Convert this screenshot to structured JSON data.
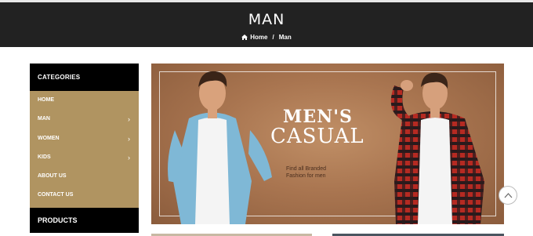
{
  "header": {
    "title": "MAN",
    "breadcrumb": {
      "home": "Home",
      "separator": "/",
      "current": "Man"
    }
  },
  "sidebar": {
    "categories_title": "CATEGORIES",
    "items": [
      {
        "label": "HOME",
        "has_children": false
      },
      {
        "label": "MAN",
        "has_children": true
      },
      {
        "label": "WOMEN",
        "has_children": true
      },
      {
        "label": "KIDS",
        "has_children": true
      },
      {
        "label": "ABOUT US",
        "has_children": false
      },
      {
        "label": "CONTACT US",
        "has_children": false
      }
    ],
    "products_title": "PRODUCTS"
  },
  "banner": {
    "title_line1": "MEN'S",
    "title_line2": "CASUAL",
    "subtitle_line1": "Find all Branded",
    "subtitle_line2": "Fashion for men"
  },
  "icons": {
    "home": "home-icon",
    "chevron": "chevron-right-icon",
    "scroll_top": "chevron-up-icon"
  },
  "colors": {
    "header_bg": "#222222",
    "category_bg": "#b09461",
    "banner_bg": "#a97550"
  }
}
